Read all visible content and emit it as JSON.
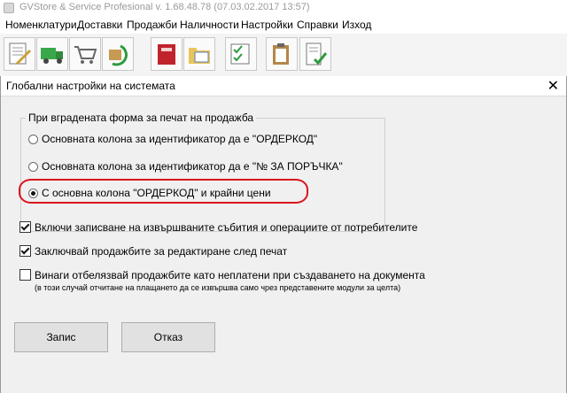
{
  "app": {
    "title": "GVStore & Service Profesional v. 1.68.48.78 (07.03.02.2017 13:57)"
  },
  "menu": [
    "Номенклатури",
    "Доставки",
    "Продажби",
    "Наличности",
    "Настройки",
    "Справки",
    "Изход"
  ],
  "toolbar_icons": [
    "document-pen-icon",
    "delivery-truck-icon",
    "shopping-cart-icon",
    "refresh-box-icon",
    "red-binder-icon",
    "folder-table-icon",
    "checklist-pen-icon",
    "clipboard-pen-icon",
    "receipt-check-icon"
  ],
  "dialog": {
    "title": "Глобални настройки на системата",
    "close_label": "✕",
    "group": {
      "label": "При вградената форма за печат на продажба",
      "options": [
        {
          "label": "Основната колона за идентификатор да е \"ОРДЕРКОД\"",
          "selected": false
        },
        {
          "label": "Основната колона за идентификатор да е \"№ ЗА ПОРЪЧКА\"",
          "selected": false
        },
        {
          "label": "С основна колона \"ОРДЕРКОД\" и крайни цени",
          "selected": true
        }
      ]
    },
    "checkboxes": [
      {
        "label": "Включи записване на извършваните събития и операциите от потребителите",
        "checked": true
      },
      {
        "label": "Заключвай продажбите за редактиране след печат",
        "checked": true
      },
      {
        "label": "Винаги отбелязвай продажбите като неплатени при създаването на документа",
        "checked": false
      }
    ],
    "note": "(в този случай отчитане на плащането да се извършва само чрез представените модули за целта)",
    "buttons": {
      "save": "Запис",
      "cancel": "Отказ"
    },
    "highlight_color": "#d9141e"
  }
}
